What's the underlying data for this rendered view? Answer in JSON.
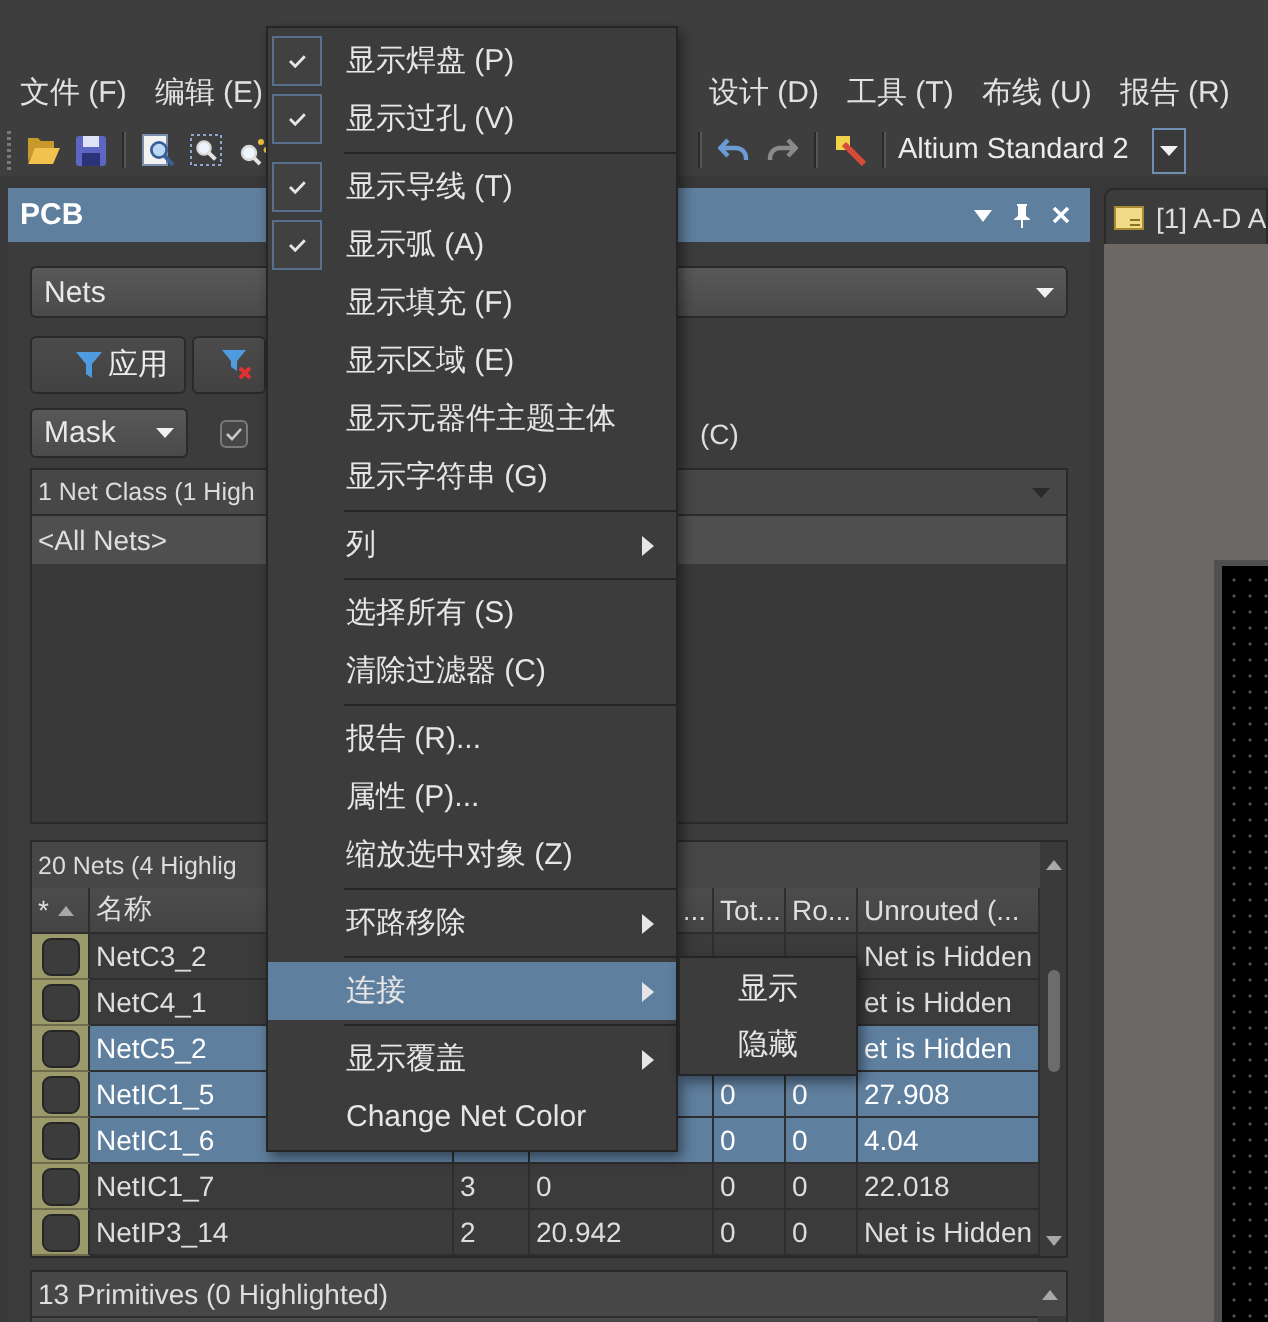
{
  "menu_bar": {
    "items": [
      "文件 (F)",
      "编辑 (E)",
      "设计 (D)",
      "工具 (T)",
      "布线 (U)",
      "报告 (R)"
    ]
  },
  "toolbar": {
    "combo_value": "Altium Standard 2"
  },
  "panel": {
    "title": "PCB",
    "scope_dropdown": "Nets",
    "filter_buttons": [
      {
        "kind": "apply",
        "label": "应用"
      },
      {
        "kind": "clear"
      }
    ],
    "mode_dropdown": "Mask",
    "checkbox_1": {
      "checked": true
    },
    "label_fragment": "(C)",
    "net_classes": {
      "header": "1 Net Class (1 High",
      "rows": [
        {
          "label": "<All Nets>",
          "selected": true
        }
      ]
    },
    "nets": {
      "title": "20 Nets (4 Highlig",
      "columns": [
        {
          "label": "*",
          "sorted": true
        },
        {
          "label": "名称"
        },
        {},
        {
          "label": "..."
        },
        {
          "label": "Tot..."
        },
        {
          "label": "Ro..."
        },
        {
          "label": "Unrouted (..."
        }
      ],
      "rows": [
        {
          "name": "NetC3_2",
          "checked": false,
          "selected": false,
          "unrouted": "Net is Hidden"
        },
        {
          "name": "NetC4_1",
          "checked": false,
          "selected": false,
          "unrouted": "et is Hidden"
        },
        {
          "name": "NetC5_2",
          "checked": false,
          "selected": true,
          "unrouted": "et is Hidden"
        },
        {
          "name": "NetIC1_5",
          "checked": false,
          "selected": true,
          "column_5": "0",
          "column_6": "0",
          "unrouted": "27.908"
        },
        {
          "name": "NetIC1_6",
          "checked": false,
          "selected": true,
          "column_5": "0",
          "column_6": "0",
          "unrouted": "4.04"
        },
        {
          "name": "NetIC1_7",
          "checked": false,
          "selected": false,
          "column_3": "3",
          "column_4": "0",
          "column_5": "0",
          "column_6": "0",
          "unrouted": "22.018"
        },
        {
          "name": "NetIP3_14",
          "checked": false,
          "selected": false,
          "column_3": "2",
          "column_4": "20.942",
          "column_5": "0",
          "column_6": "0",
          "unrouted": "Net is Hidden"
        }
      ]
    },
    "primitives": {
      "title": "13 Primitives (0 Highlighted)"
    }
  },
  "document_tab": {
    "title": "[1] A-D A"
  },
  "context_menu": {
    "items": [
      {
        "kind": "check",
        "label": "显示焊盘 (P)",
        "checked": true,
        "selected": false
      },
      {
        "kind": "check",
        "label": "显示过孔 (V)",
        "checked": true,
        "selected": false
      },
      {
        "kind": "separator"
      },
      {
        "kind": "check",
        "label": "显示导线 (T)",
        "checked": true,
        "selected": false
      },
      {
        "kind": "check",
        "label": "显示弧 (A)",
        "checked": true,
        "selected": false
      },
      {
        "kind": "check",
        "label": "显示填充 (F)",
        "checked": false,
        "selected": false
      },
      {
        "kind": "check",
        "label": "显示区域 (E)",
        "checked": false,
        "selected": false
      },
      {
        "kind": "check",
        "label": "显示元器件主题主体",
        "checked": false,
        "selected": false
      },
      {
        "kind": "check",
        "label": "显示字符串 (G)",
        "checked": false,
        "selected": false
      },
      {
        "kind": "separator"
      },
      {
        "kind": "submenu",
        "label": "列",
        "selected": false
      },
      {
        "kind": "separator"
      },
      {
        "kind": "command",
        "label": "选择所有 (S)",
        "selected": false
      },
      {
        "kind": "command",
        "label": "清除过滤器 (C)",
        "selected": false
      },
      {
        "kind": "separator"
      },
      {
        "kind": "command",
        "label": "报告 (R)...",
        "selected": false
      },
      {
        "kind": "command",
        "label": "属性 (P)...",
        "selected": false
      },
      {
        "kind": "command",
        "label": "缩放选中对象 (Z)",
        "selected": false
      },
      {
        "kind": "separator"
      },
      {
        "kind": "submenu",
        "label": "环路移除",
        "selected": false
      },
      {
        "kind": "separator"
      },
      {
        "kind": "submenu",
        "label": "连接",
        "selected": true,
        "submenu": [
          {
            "label": "显示",
            "selected": false
          },
          {
            "label": "隐藏",
            "selected": false
          }
        ]
      },
      {
        "kind": "separator"
      },
      {
        "kind": "submenu",
        "label": "显示覆盖",
        "selected": false
      },
      {
        "kind": "command",
        "label": "Change Net Color",
        "selected": false
      }
    ]
  }
}
